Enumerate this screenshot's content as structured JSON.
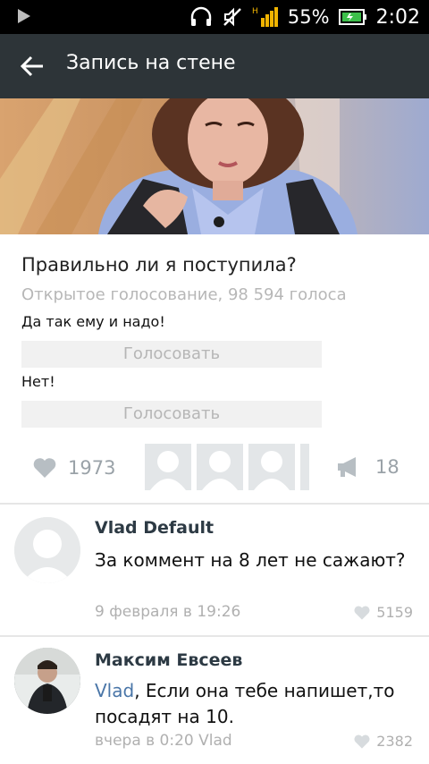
{
  "status_bar": {
    "battery": "55%",
    "time": "2:02"
  },
  "app_bar": {
    "title": "Запись на стене"
  },
  "poll": {
    "question": "Правильно ли я поступила?",
    "meta": "Открытое голосование, 98 594 голоса",
    "options": [
      {
        "label": "Да так ему и надо!",
        "button": "Голосовать"
      },
      {
        "label": "Нет!",
        "button": "Голосовать"
      }
    ]
  },
  "actions": {
    "likes": "1973",
    "shares": "18"
  },
  "comments": [
    {
      "author": "Vlad Default",
      "text": "За коммент на 8 лет не сажают?",
      "time": "9 февраля в 19:26",
      "likes": "5159"
    },
    {
      "author": "Максим Евсеев",
      "mention": "Vlad",
      "text": ", Если она тебе напишет,то посадят на 10.",
      "time": "вчера в 0:20 Vlad",
      "likes": "2382"
    }
  ],
  "colors": {
    "app_bar": "#2d3438",
    "status_bar": "#000000",
    "signal": "#f1b400",
    "battery": "#3cbf4a",
    "mention": "#4a76a8"
  },
  "icons": [
    "play-icon",
    "headphones-icon",
    "mute-icon",
    "signal-icon",
    "battery-icon",
    "back-arrow-icon",
    "heart-icon",
    "megaphone-icon"
  ]
}
